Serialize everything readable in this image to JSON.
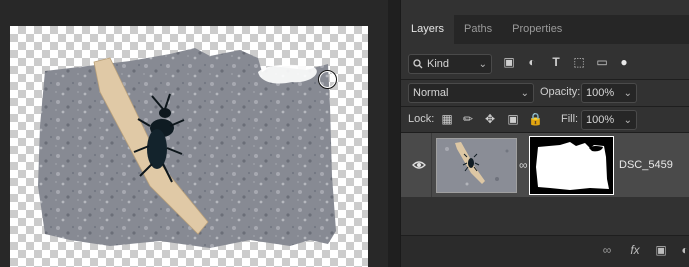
{
  "panel": {
    "tabs": [
      {
        "label": "Layers",
        "active": true
      },
      {
        "label": "Paths",
        "active": false
      },
      {
        "label": "Properties",
        "active": false
      }
    ],
    "filter": {
      "kind_label": "Kind",
      "icons": [
        "pixel-filter-icon",
        "adjustment-filter-icon",
        "type-filter-icon",
        "shape-filter-icon",
        "smart-object-filter-icon",
        "filter-toggle-icon"
      ]
    },
    "blend_mode": "Normal",
    "opacity_label": "Opacity:",
    "opacity_value": "100%",
    "lock_label": "Lock:",
    "lock_icons": [
      "lock-transparent-pixels-icon",
      "lock-image-pixels-icon",
      "lock-position-icon",
      "lock-artboard-icon",
      "lock-all-icon"
    ],
    "fill_label": "Fill:",
    "fill_value": "100%",
    "layers": [
      {
        "name": "DSC_5459",
        "visible": true,
        "has_mask": true,
        "smart_object": true
      }
    ],
    "footer_icons": [
      "link-layers-icon",
      "layer-style-fx-icon",
      "add-mask-icon",
      "new-fill-adjustment-icon",
      "new-group-icon"
    ]
  },
  "colors": {
    "panel_bg": "#323232",
    "tab_bar_bg": "#262626",
    "selected_layer_bg": "#4a4a4a",
    "canvas_bg": "#282828"
  }
}
